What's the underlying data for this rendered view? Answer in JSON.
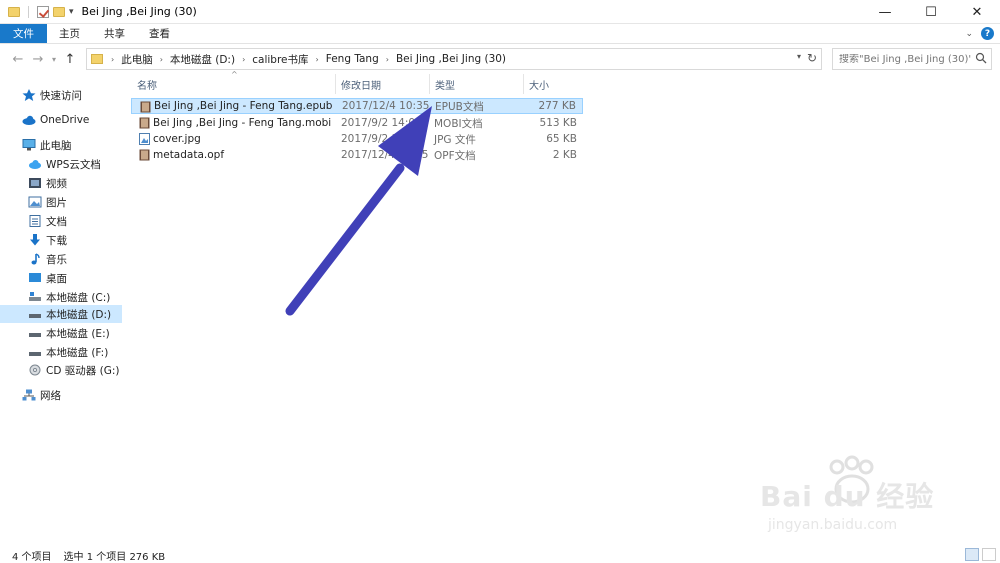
{
  "window": {
    "title": "Bei Jing ,Bei Jing (30)"
  },
  "window_controls": {
    "minimize": "—",
    "maximize": "☐",
    "close": "✕"
  },
  "ribbon": {
    "tabs": [
      "文件",
      "主页",
      "共享",
      "查看"
    ],
    "help": "?"
  },
  "address": {
    "crumbs": [
      "此电脑",
      "本地磁盘 (D:)",
      "calibre书库",
      "Feng Tang",
      "Bei Jing ,Bei Jing (30)"
    ]
  },
  "search": {
    "placeholder": "搜索\"Bei Jing ,Bei Jing (30)\""
  },
  "sidebar": {
    "items": [
      {
        "label": "快速访问",
        "icon": "star-icon"
      },
      {
        "label": "OneDrive",
        "icon": "cloud-icon"
      },
      {
        "label": "此电脑",
        "icon": "computer-icon"
      },
      {
        "label": "WPS云文档",
        "icon": "cloud-doc-icon"
      },
      {
        "label": "视频",
        "icon": "video-icon"
      },
      {
        "label": "图片",
        "icon": "picture-icon"
      },
      {
        "label": "文档",
        "icon": "document-icon"
      },
      {
        "label": "下载",
        "icon": "download-icon"
      },
      {
        "label": "音乐",
        "icon": "music-icon"
      },
      {
        "label": "桌面",
        "icon": "desktop-icon"
      },
      {
        "label": "本地磁盘 (C:)",
        "icon": "drive-icon"
      },
      {
        "label": "本地磁盘 (D:)",
        "icon": "drive-icon"
      },
      {
        "label": "本地磁盘 (E:)",
        "icon": "drive-icon"
      },
      {
        "label": "本地磁盘 (F:)",
        "icon": "drive-icon"
      },
      {
        "label": "CD 驱动器 (G:)",
        "icon": "cd-icon"
      },
      {
        "label": "网络",
        "icon": "network-icon"
      }
    ],
    "selected": "本地磁盘 (D:)"
  },
  "columns": {
    "name": "名称",
    "date": "修改日期",
    "type": "类型",
    "size": "大小"
  },
  "files": [
    {
      "name": "Bei Jing ,Bei Jing - Feng Tang.epub",
      "date": "2017/12/4 10:35",
      "type": "EPUB文档",
      "size": "277 KB",
      "icon": "book-icon"
    },
    {
      "name": "Bei Jing ,Bei Jing - Feng Tang.mobi",
      "date": "2017/9/2 14:00",
      "type": "MOBI文档",
      "size": "513 KB",
      "icon": "book-icon"
    },
    {
      "name": "cover.jpg",
      "date": "2017/9/2 14:00",
      "type": "JPG 文件",
      "size": "65 KB",
      "icon": "image-file-icon"
    },
    {
      "name": "metadata.opf",
      "date": "2017/12/4 10:35",
      "type": "OPF文档",
      "size": "2 KB",
      "icon": "book-icon"
    }
  ],
  "selected_file": "Bei Jing ,Bei Jing - Feng Tang.epub",
  "status": {
    "count": "4 个项目",
    "selection": "选中 1 个项目  276 KB"
  },
  "watermark": {
    "brand": "Bai du 经验",
    "url": "jingyan.baidu.com"
  },
  "colors": {
    "accent": "#1979ca",
    "selection": "#cce8ff",
    "arrow": "#3f3fb8"
  }
}
